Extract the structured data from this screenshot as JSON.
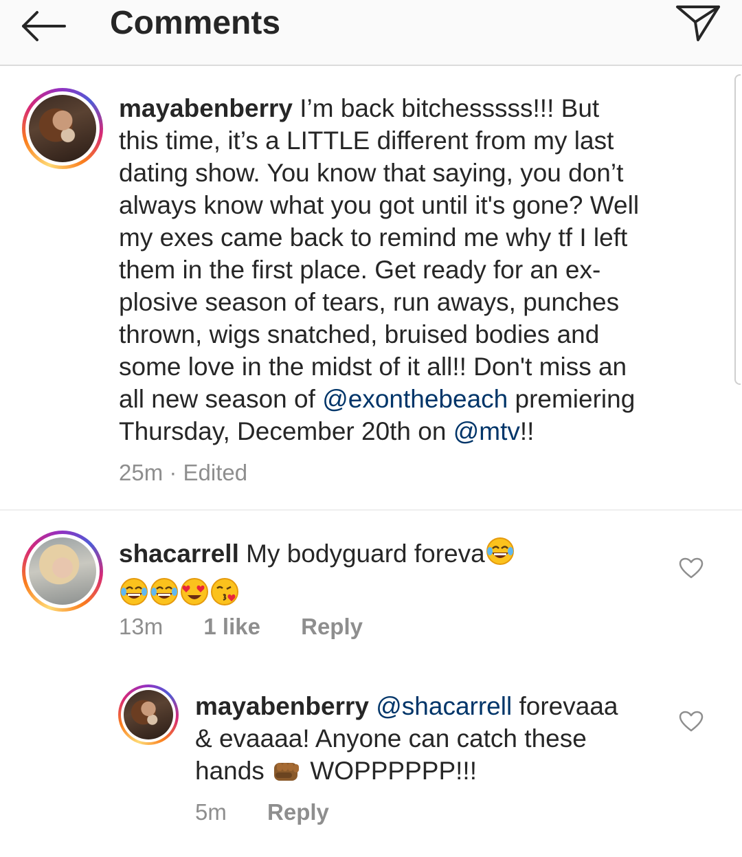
{
  "header": {
    "title": "Comments"
  },
  "caption": {
    "username": "mayabenberry",
    "text_part1": " I’m back bitchesssss!!! But",
    "line2": "this time, it’s a LITTLE different from my last",
    "line3": "dating show. You know that saying, you don’t",
    "line4": "always know what you got until it's gone? Well",
    "line5": "my exes came back to remind me why tf I left",
    "line6": "them in the first place. Get ready for an ex-",
    "line7": "plosive season of tears, run aways, punches",
    "line8": "thrown, wigs snatched, bruised bodies and",
    "line9": "some love in the midst of it all!! Don't miss an",
    "line10_prefix": "all new season of ",
    "mention1": "@exonthebeach",
    "line10_suffix": " premiering",
    "line11_prefix": "Thursday, December 20th on ",
    "mention2": "@mtv",
    "line11_suffix": "!!",
    "time": "25m",
    "separator": " · ",
    "edited": "Edited"
  },
  "comment1": {
    "username": "shacarrell",
    "text": " My bodyguard foreva",
    "time": "13m",
    "likes": "1 like",
    "reply_label": "Reply"
  },
  "reply1": {
    "username": "mayabenberry",
    "mention": "@shacarrell",
    "text_part1": " forevaaa",
    "line2": "& evaaaa! Anyone can catch these",
    "line3_prefix": "hands ",
    "line3_suffix": " WOPPPPPP!!!",
    "time": "5m",
    "reply_label": "Reply"
  },
  "icons": {
    "back": "arrow-left-icon",
    "share": "paper-plane-icon",
    "like": "heart-outline-icon",
    "emoji_joy": "face-with-tears-of-joy-icon",
    "emoji_heart_eyes": "heart-eyes-icon",
    "emoji_kiss": "face-blowing-kiss-icon",
    "emoji_fist": "oncoming-fist-icon"
  },
  "colors": {
    "mention": "#003569",
    "meta": "#8e8e8e",
    "text": "#262626"
  }
}
